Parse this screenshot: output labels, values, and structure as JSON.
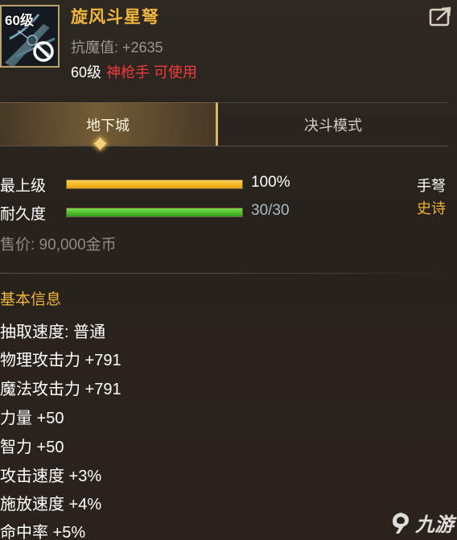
{
  "item": {
    "level_tag": "60级",
    "name": "旋风斗星弩",
    "anti_magic": "抗魔值: +2635",
    "req_level": "60级",
    "req_class": "神枪手 可使用"
  },
  "tabs": [
    {
      "label": "地下城",
      "active": true
    },
    {
      "label": "决斗模式",
      "active": false
    }
  ],
  "stats": {
    "grade_label": "最上级",
    "grade_value": "100%",
    "grade_fraction": 1.0,
    "durability_label": "耐久度",
    "durability_value": "30/30",
    "durability_fraction": 1.0,
    "weapon_type": "手弩",
    "rarity": "史诗",
    "price": "售价: 90,000金币"
  },
  "basic_info": {
    "title": "基本信息",
    "lines": [
      "抽取速度: 普通",
      "物理攻击力 +791",
      "魔法攻击力 +791",
      "力量 +50",
      "智力 +50",
      "攻击速度 +3%",
      "施放速度 +4%",
      "命中率 +5%"
    ]
  },
  "watermark": {
    "text": "九游"
  },
  "colors": {
    "gold_text": "#f0b63c",
    "red_text": "#f13b3b",
    "grade_bar": "#e9a20f",
    "durability_bar": "#2f9d16",
    "panel_bg": "#2b2520"
  },
  "icons": [
    "no-entry-icon",
    "share-icon",
    "tab-diamond-icon",
    "jiuyou-logo-icon"
  ]
}
